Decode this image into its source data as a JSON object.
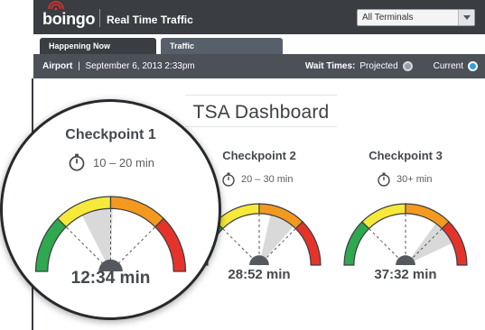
{
  "header": {
    "brand": "boingo",
    "title": "Real Time Traffic",
    "terminal_select": "All Terminals"
  },
  "tabs": [
    {
      "label": "Happening Now",
      "active": true
    },
    {
      "label": "Traffic",
      "active": false
    }
  ],
  "infobar": {
    "location": "Airport",
    "separator": "|",
    "datetime": "September 6, 2013 2:33pm",
    "wait_times_label": "Wait Times:",
    "projected_label": "Projected",
    "current_label": "Current",
    "selected": "Current"
  },
  "dashboard": {
    "title": "TSA Dashboard",
    "checkpoints": [
      {
        "name": "Checkpoint 1",
        "range": "10 – 20 min",
        "time": "12:34 min",
        "needle_fraction": 0.43
      },
      {
        "name": "Checkpoint 2",
        "range": "20 – 30 min",
        "time": "28:52 min",
        "needle_fraction": 0.65
      },
      {
        "name": "Checkpoint 3",
        "range": "30+ min",
        "time": "37:32 min",
        "needle_fraction": 0.78
      }
    ]
  },
  "colors": {
    "gauge_green": "#2fa84f",
    "gauge_yellow": "#f6e93a",
    "gauge_orange": "#f39a1e",
    "gauge_red": "#e5332a",
    "needle_fill": "#d9d9d9",
    "hub": "#55595f",
    "current_radio": "#2f9fe0"
  }
}
